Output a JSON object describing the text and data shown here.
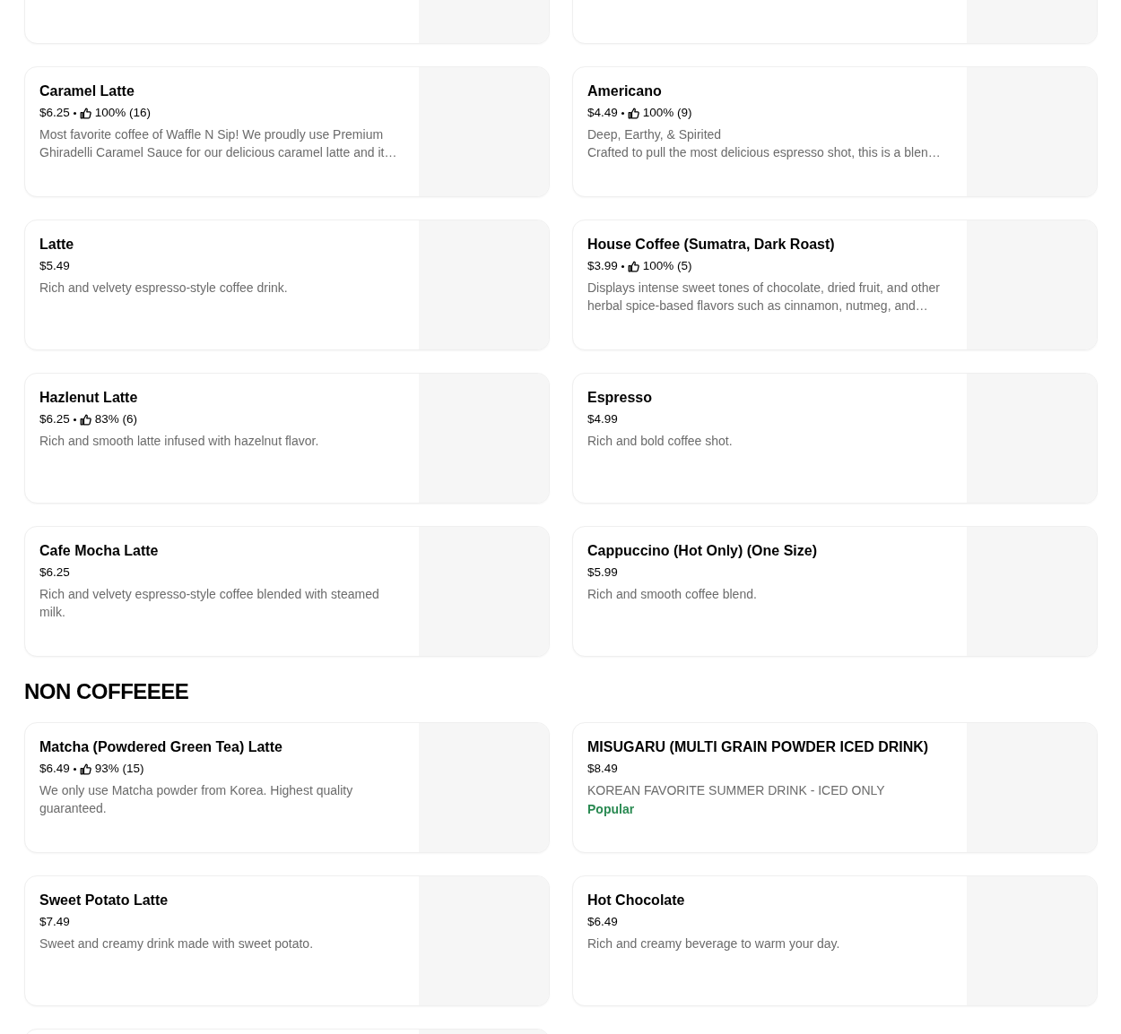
{
  "partial_top_row": [
    {
      "kind": "card"
    },
    {
      "kind": "card"
    }
  ],
  "sections": [
    {
      "items": [
        {
          "name": "Caramel Latte",
          "price": "$6.25",
          "rating": "100% (16)",
          "description": [
            "Most favorite coffee of Waffle N Sip! We proudly use Premium Ghiradelli Caramel Sauce for our delicious caramel latte and it…"
          ]
        },
        {
          "name": "Americano",
          "price": "$4.49",
          "rating": "100% (9)",
          "description": [
            "Deep, Earthy, & Spirited",
            "Crafted to pull the most delicious espresso shot, this is a blen…"
          ]
        },
        {
          "name": "Latte",
          "price": "$5.49",
          "description": [
            "Rich and velvety espresso-style coffee drink."
          ]
        },
        {
          "name": "House Coffee (Sumatra, Dark Roast)",
          "price": "$3.99",
          "rating": "100% (5)",
          "description": [
            "Displays intense sweet tones of chocolate, dried fruit, and other herbal spice-based flavors such as cinnamon, nutmeg, and…"
          ]
        },
        {
          "name": "Hazlenut Latte",
          "price": "$6.25",
          "rating": "83% (6)",
          "description": [
            "Rich and smooth latte infused with hazelnut flavor."
          ]
        },
        {
          "name": "Espresso",
          "price": "$4.99",
          "description": [
            "Rich and bold coffee shot."
          ]
        },
        {
          "name": "Cafe Mocha Latte",
          "price": "$6.25",
          "description": [
            "Rich and velvety espresso-style coffee blended with steamed milk."
          ]
        },
        {
          "name": "Cappuccino (Hot Only) (One Size)",
          "price": "$5.99",
          "description": [
            "Rich and smooth coffee blend."
          ]
        }
      ]
    },
    {
      "heading": "NON COFFEEEE",
      "items": [
        {
          "name": "Matcha (Powdered Green Tea) Latte",
          "price": "$6.49",
          "rating": "93% (15)",
          "description": [
            "We only use Matcha powder from Korea. Highest quality guaranteed."
          ]
        },
        {
          "name": "MISUGARU (MULTI GRAIN POWDER ICED DRINK)",
          "price": "$8.49",
          "description": [
            "KOREAN FAVORITE SUMMER DRINK - ICED ONLY"
          ],
          "badge": "Popular"
        },
        {
          "name": "Sweet Potato Latte",
          "price": "$7.49",
          "description": [
            "Sweet and creamy drink made with sweet potato."
          ]
        },
        {
          "name": "Hot Chocolate",
          "price": "$6.49",
          "description": [
            "Rich and creamy beverage to warm your day."
          ]
        }
      ]
    }
  ],
  "partial_bottom_row": [
    {
      "kind": "card"
    }
  ]
}
